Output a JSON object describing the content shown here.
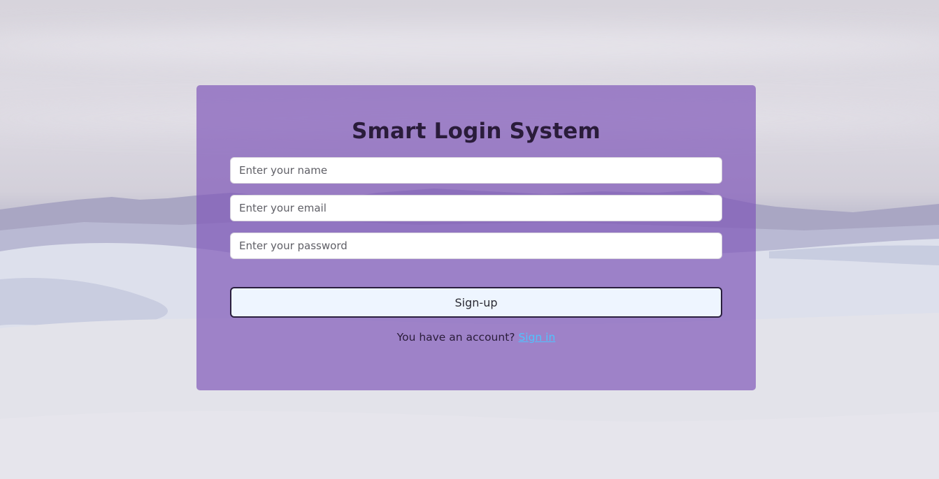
{
  "form": {
    "title": "Smart Login System",
    "name_placeholder": "Enter your name",
    "email_placeholder": "Enter your email",
    "password_placeholder": "Enter your password",
    "submit_label": "Sign-up",
    "account_prompt": "You have an account? ",
    "signin_link": "Sign in"
  },
  "theme": {
    "card_color": "#8058b9",
    "button_bg": "#eef5ff",
    "link_color": "#4fc3ff",
    "title_color": "#2a1c3a"
  }
}
